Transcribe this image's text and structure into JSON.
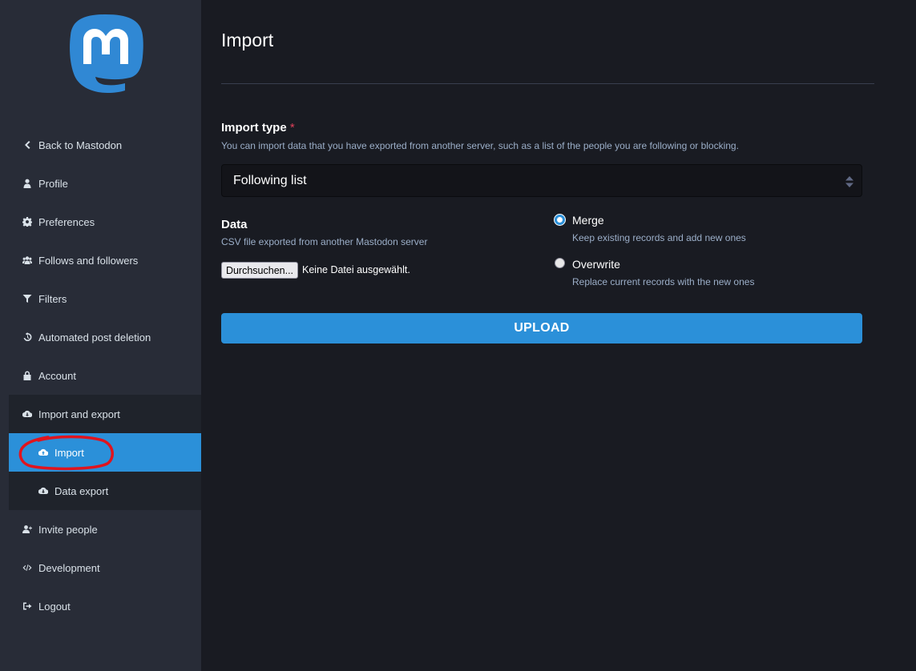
{
  "sidebar": {
    "items": [
      {
        "label": "Back to Mastodon",
        "icon": "chevron-left-icon"
      },
      {
        "label": "Profile",
        "icon": "user-icon"
      },
      {
        "label": "Preferences",
        "icon": "gear-icon"
      },
      {
        "label": "Follows and followers",
        "icon": "users-icon"
      },
      {
        "label": "Filters",
        "icon": "filter-icon"
      },
      {
        "label": "Automated post deletion",
        "icon": "history-icon"
      },
      {
        "label": "Account",
        "icon": "lock-icon"
      },
      {
        "label": "Import and export",
        "icon": "cloud-download-icon"
      },
      {
        "label": "Import",
        "icon": "cloud-upload-icon",
        "active": true
      },
      {
        "label": "Data export",
        "icon": "cloud-download-icon"
      },
      {
        "label": "Invite people",
        "icon": "user-plus-icon"
      },
      {
        "label": "Development",
        "icon": "code-icon"
      },
      {
        "label": "Logout",
        "icon": "sign-out-icon"
      }
    ]
  },
  "main": {
    "title": "Import",
    "import_type": {
      "label": "Import type",
      "required_mark": "*",
      "hint": "You can import data that you have exported from another server, such as a list of the people you are following or blocking.",
      "selected": "Following list"
    },
    "data": {
      "label": "Data",
      "hint": "CSV file exported from another Mastodon server",
      "browse_button": "Durchsuchen...",
      "no_file": "Keine Datei ausgewählt."
    },
    "mode": {
      "options": [
        {
          "label": "Merge",
          "hint": "Keep existing records and add new ones",
          "checked": true
        },
        {
          "label": "Overwrite",
          "hint": "Replace current records with the new ones",
          "checked": false
        }
      ]
    },
    "upload_label": "UPLOAD"
  },
  "colors": {
    "accent": "#2b90d9",
    "sidebar_bg": "#282c37",
    "main_bg": "#191b22",
    "annotation": "#e0141e"
  }
}
